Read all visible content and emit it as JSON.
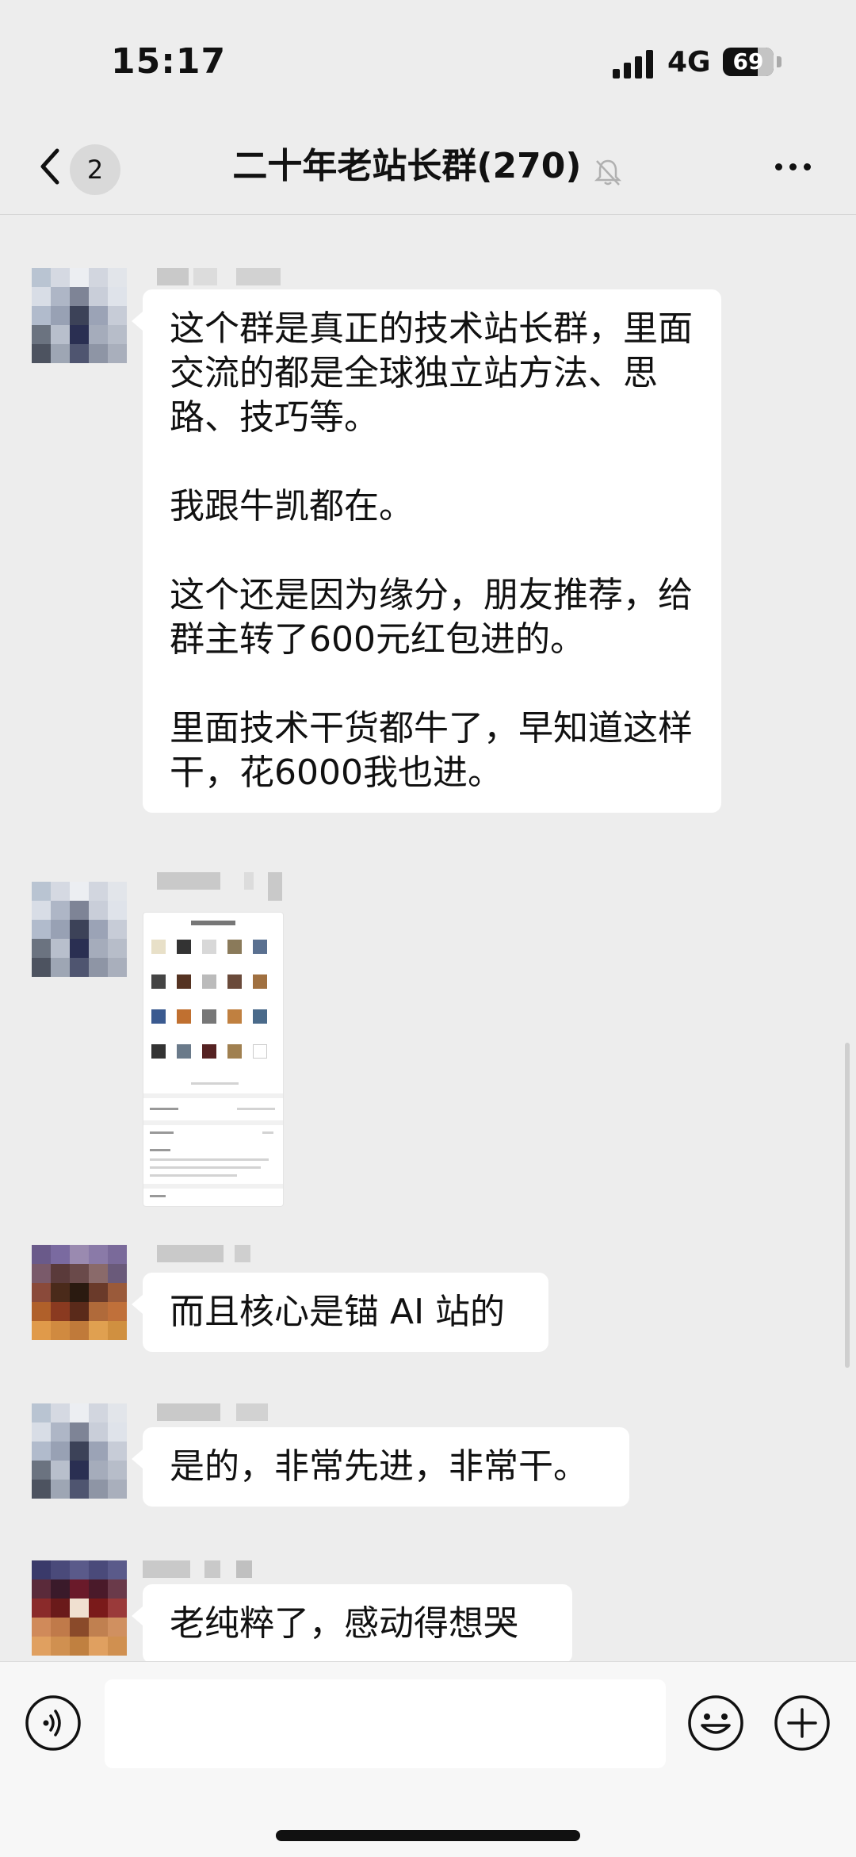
{
  "status_bar": {
    "time": "15:17",
    "network": "4G",
    "battery": "69"
  },
  "nav": {
    "unread_count": "2",
    "title": "二十年老站长群(270)"
  },
  "icons": {
    "back": "chevron-left-icon",
    "mute": "bell-slash-icon",
    "more": "more-dots-icon",
    "voice": "voice-icon",
    "emoji": "emoji-icon",
    "plus": "plus-icon"
  },
  "messages": [
    {
      "type": "text",
      "paragraphs": [
        "这个群是真正的技术站长群，里面交流的都是全球独立站方法、思路、技巧等。",
        "我跟牛凯都在。",
        "这个还是因为缘分，朋友推荐，给群主转了600元红包进的。",
        "里面技术干货都牛了，早知道这样干，花6000我也进。"
      ]
    },
    {
      "type": "image"
    },
    {
      "type": "text",
      "paragraphs": [
        "而且核心是锚 AI 站的"
      ]
    },
    {
      "type": "text",
      "paragraphs": [
        "是的，非常先进，非常干。"
      ]
    },
    {
      "type": "text",
      "paragraphs": [
        "老纯粹了，感动得想哭"
      ]
    }
  ],
  "input": {
    "value": "",
    "placeholder": ""
  }
}
